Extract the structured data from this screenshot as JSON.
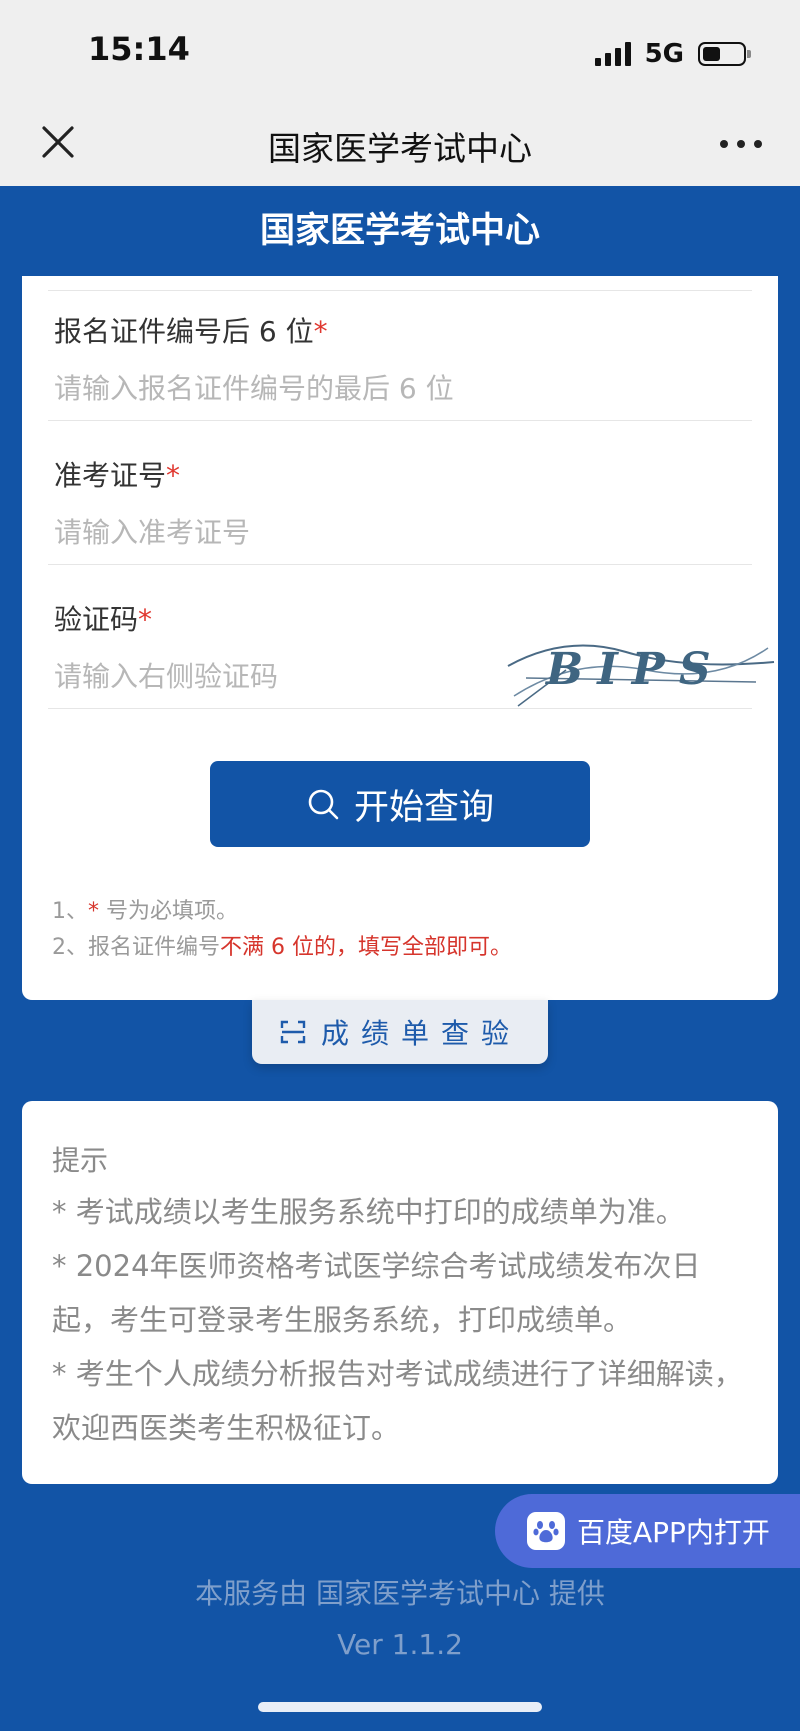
{
  "status_bar": {
    "time": "15:14",
    "network": "5G",
    "battery_level": 0.45
  },
  "nav_bar": {
    "title": "国家医学考试中心"
  },
  "site_header": {
    "title": "国家医学考试中心"
  },
  "form": {
    "id_last6": {
      "label": "报名证件编号后 6 位",
      "required_mark": "*",
      "placeholder": "请输入报名证件编号的最后 6 位",
      "value": ""
    },
    "admission_no": {
      "label": "准考证号",
      "required_mark": "*",
      "placeholder": "请输入准考证号",
      "value": ""
    },
    "captcha": {
      "label": "验证码",
      "required_mark": "*",
      "placeholder": "请输入右侧验证码",
      "value": "",
      "image_text": "BIPS"
    },
    "query_button": {
      "label": "开始查询",
      "icon": "search-icon"
    },
    "notes": {
      "line1_prefix": "1、",
      "line1_star": "*",
      "line1_text": " 号为必填项。",
      "line2_prefix": "2、报名证件编号",
      "line2_red": "不满 6 位的，填写全部即可。"
    }
  },
  "verify_tab": {
    "label": "成绩单查验",
    "icon": "scan-icon"
  },
  "tips": {
    "title": "提示",
    "items": [
      "* 考试成绩以考生服务系统中打印的成绩单为准。",
      "* 2024年医师资格考试医学综合考试成绩发布次日起，考生可登录考生服务系统，打印成绩单。",
      "* 考生个人成绩分析报告对考试成绩进行了详细解读，欢迎西医类考生积极征订。"
    ]
  },
  "baidu_button": {
    "label": "百度APP内打开",
    "icon": "baidu-paw-icon"
  },
  "footer": {
    "provider": "本服务由 国家医学考试中心 提供",
    "version": "Ver 1.1.2"
  },
  "colors": {
    "primary": "#1254a6",
    "required": "#e0372f",
    "baidu": "#4e6ad8"
  }
}
